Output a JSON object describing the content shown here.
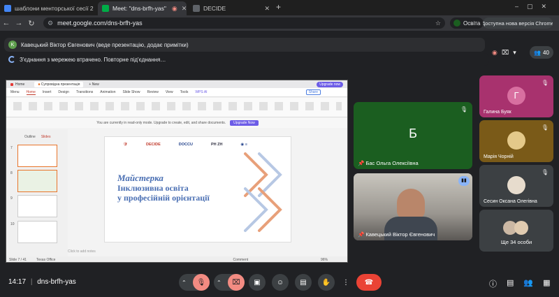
{
  "tabs": [
    {
      "label": "шаблони менторської сесії 2",
      "color": "#4285f4"
    },
    {
      "label": "Meet: \"dns-brfh-yas\"",
      "color": "#f9ab00"
    },
    {
      "label": "DECIDE",
      "color": "#5f6368"
    }
  ],
  "url": "meet.google.com/dns-brfh-yas",
  "profile_label": "Освіта",
  "update_label": "Доступна нова версія Chrome",
  "presenter_banner": "Кавецький Віктор Євгенович (веде презентацію, додає примітки)",
  "reconnect_text": "З'єднання з мережею втрачено. Повторне під'єднання…",
  "participant_count": "40",
  "slides": {
    "tab_home": "Home",
    "tab_title": "Супровідна презентація",
    "ribbon": [
      "Menu",
      "Home",
      "Insert",
      "Design",
      "Transitions",
      "Animation",
      "Slide Show",
      "Review",
      "View",
      "Tools",
      "WPS AI"
    ],
    "upgrade_now": "Upgrade now",
    "share": "Share",
    "readonly": "You are currently in read-only mode. Upgrade to create, edit, and share documents.",
    "upgrade_btn": "Upgrade Now",
    "panel_tabs": [
      "Outline",
      "Slides"
    ],
    "thumb_numbers": [
      "7",
      "8",
      "9",
      "10"
    ],
    "slide_title": [
      "Майстерка",
      "Інклюзивна освіта",
      "у професійній орієнтації"
    ],
    "logos": [
      "DECIDE",
      "DOCCU",
      "PH ZH"
    ],
    "notes": "Click to add notes",
    "status": [
      "Slide 7 / 41",
      "Texas Office",
      "Comment"
    ],
    "zoom": "96%"
  },
  "participants": [
    {
      "name": "Галина Буяк",
      "initial": "Г",
      "color": "#a8326e"
    },
    {
      "name": "Бас Ольга Олексіївна",
      "initial": "Б",
      "color": "#1b5e20"
    },
    {
      "name": "Марія Чорній",
      "initial": "",
      "color": "#7a5a18"
    },
    {
      "name": "Кавецький Віктор Євгенович",
      "initial": "",
      "color": "#7b7f83"
    },
    {
      "name": "Сесин Оксана Олегівна",
      "initial": "",
      "color": "#5a4a2a"
    },
    {
      "name": "Ще 34 особи",
      "initial": "",
      "color": "#3c4043"
    }
  ],
  "time": "14:17",
  "meeting_code": "dns-brfh-yas"
}
